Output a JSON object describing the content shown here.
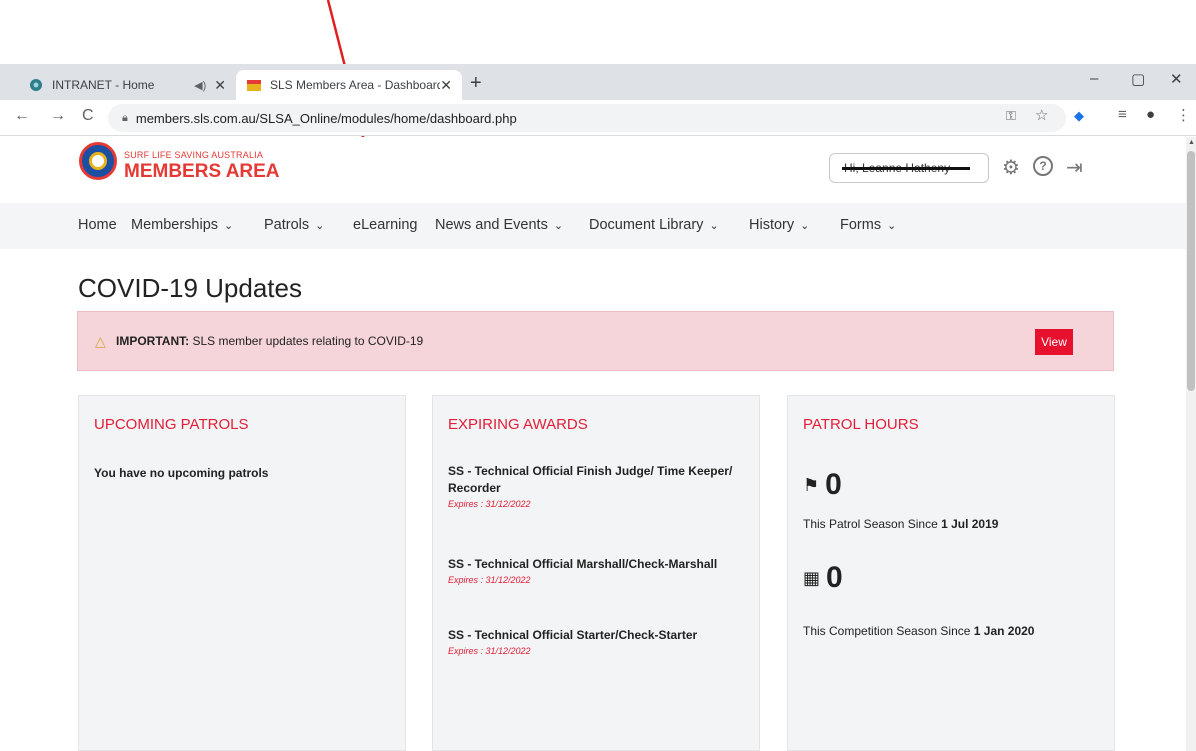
{
  "browser": {
    "tabs": [
      {
        "title": "INTRANET - Home",
        "favicon": "intranet-favicon",
        "active": false
      },
      {
        "title": "SLS Members Area - Dashboard",
        "favicon": "sls-favicon",
        "active": true
      }
    ],
    "new_tab_symbol": "+",
    "close_symbol": "✕",
    "window_controls": {
      "minimize": "–",
      "maximize": "▢",
      "close": "✕"
    },
    "url": "members.sls.com.au/SLSA_Online/modules/home/dashboard.php",
    "nav": {
      "back": "←",
      "forward": "→",
      "reload": "C"
    },
    "toolbar_icons": {
      "key": "⚿",
      "star": "☆",
      "extension": "◆",
      "queue": "≡",
      "profile": "●",
      "menu": "⋮"
    }
  },
  "site": {
    "logo_small": "SURF LIFE SAVING AUSTRALIA",
    "logo_big": "MEMBERS AREA",
    "user_greeting": "Hi, Leanne Hatheny",
    "header_icons": {
      "settings": "⚙",
      "help": "?",
      "logout": "⇥"
    }
  },
  "nav": [
    {
      "label": "Home",
      "has_dropdown": false
    },
    {
      "label": "Memberships",
      "has_dropdown": true
    },
    {
      "label": "Patrols",
      "has_dropdown": true
    },
    {
      "label": "eLearning",
      "has_dropdown": false
    },
    {
      "label": "News and Events",
      "has_dropdown": true
    },
    {
      "label": "Document Library",
      "has_dropdown": true
    },
    {
      "label": "History",
      "has_dropdown": true
    },
    {
      "label": "Forms",
      "has_dropdown": true
    }
  ],
  "chevron": "⌄",
  "page_title": "COVID-19 Updates",
  "alert": {
    "strong": "IMPORTANT:",
    "text": " SLS member updates relating to COVID-19",
    "button": "View"
  },
  "cards": {
    "upcoming": {
      "title": "UPCOMING PATROLS",
      "text": "You have no upcoming patrols"
    },
    "expiring": {
      "title": "EXPIRING AWARDS",
      "items": [
        {
          "name": "SS - Technical Official Finish Judge/ Time Keeper/ Recorder",
          "expires": "Expires : 31/12/2022"
        },
        {
          "name": "SS - Technical Official Marshall/Check-Marshall",
          "expires": "Expires : 31/12/2022"
        },
        {
          "name": "SS - Technical Official Starter/Check-Starter",
          "expires": "Expires : 31/12/2022"
        }
      ]
    },
    "hours": {
      "title": "PATROL HOURS",
      "patrol_value": "0",
      "patrol_prefix": "This Patrol Season Since ",
      "patrol_date": "1 Jul 2019",
      "comp_value": "0",
      "comp_prefix": "This Competition Season Since ",
      "comp_date": "1 Jan 2020"
    }
  },
  "colors": {
    "accent_red": "#e11d38",
    "annotation_arrow": "#e02020"
  }
}
